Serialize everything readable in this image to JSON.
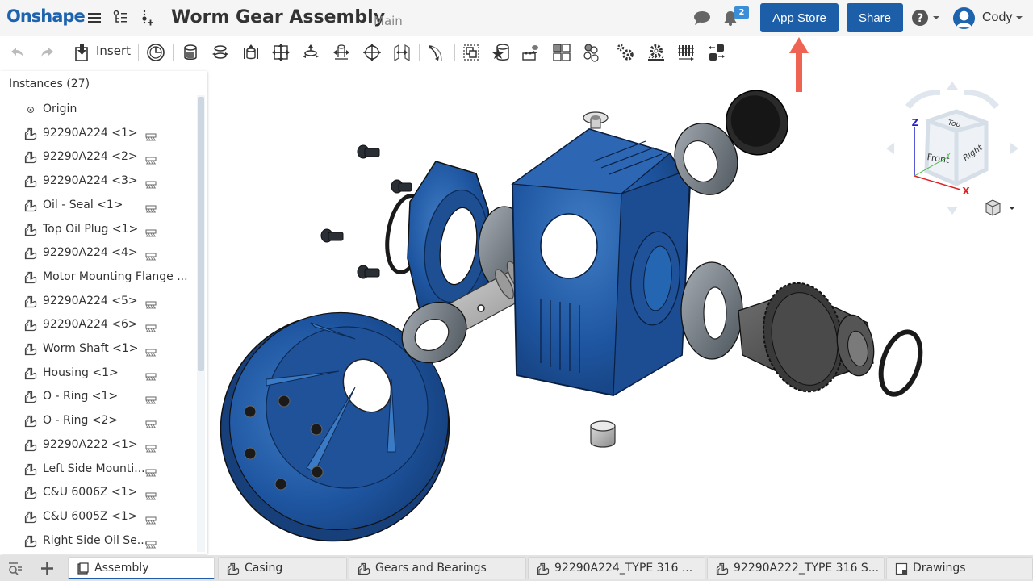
{
  "app": {
    "logo": "Onshape"
  },
  "header": {
    "title": "Worm Gear Assembly",
    "branch": "Main",
    "notification_count": "2",
    "app_store_label": "App Store",
    "share_label": "Share",
    "user_name": "Cody",
    "accent_color": "#1d5ea8"
  },
  "toolbar": {
    "insert_label": "Insert",
    "icons": [
      "undo-icon",
      "redo-icon",
      "insert-icon",
      "history-icon",
      "fastened-mate-icon",
      "revolute-mate-icon",
      "slider-mate-icon",
      "planar-mate-icon",
      "cylindrical-mate-icon",
      "pin-slot-mate-icon",
      "ball-mate-icon",
      "parallel-mate-icon",
      "tangent-mate-icon",
      "group-icon",
      "replicate-icon",
      "mate-connector-icon",
      "pattern-icon",
      "relations-icon",
      "gear-relation-icon",
      "rack-pinion-icon",
      "screw-relation-icon",
      "linear-relation-icon"
    ]
  },
  "instances": {
    "title": "Instances (27)",
    "items": [
      {
        "label": "Origin",
        "type": "origin",
        "mate": false
      },
      {
        "label": "92290A224 <1>",
        "type": "part",
        "mate": true
      },
      {
        "label": "92290A224 <2>",
        "type": "part",
        "mate": true
      },
      {
        "label": "92290A224 <3>",
        "type": "part",
        "mate": true
      },
      {
        "label": "Oil - Seal <1>",
        "type": "part",
        "mate": true
      },
      {
        "label": "Top Oil Plug <1>",
        "type": "part",
        "mate": true
      },
      {
        "label": "92290A224 <4>",
        "type": "part",
        "mate": true
      },
      {
        "label": "Motor Mounting Flange ...",
        "type": "part",
        "mate": false
      },
      {
        "label": "92290A224 <5>",
        "type": "part",
        "mate": true
      },
      {
        "label": "92290A224 <6>",
        "type": "part",
        "mate": true
      },
      {
        "label": "Worm Shaft <1>",
        "type": "part",
        "mate": true
      },
      {
        "label": "Housing <1>",
        "type": "part",
        "mate": true
      },
      {
        "label": "O - Ring <1>",
        "type": "part",
        "mate": true
      },
      {
        "label": "O - Ring <2>",
        "type": "part",
        "mate": true
      },
      {
        "label": "92290A222 <1>",
        "type": "part",
        "mate": true
      },
      {
        "label": "Left Side Mounti...",
        "type": "part",
        "mate": true
      },
      {
        "label": "C&U 6006Z <1>",
        "type": "part",
        "mate": true
      },
      {
        "label": "C&U 6005Z <1>",
        "type": "part",
        "mate": true
      },
      {
        "label": "Right Side Oil Se...",
        "type": "part",
        "mate": true
      }
    ]
  },
  "viewcube": {
    "faces": {
      "top": "Top",
      "front": "Front",
      "right": "Right"
    },
    "axes": {
      "x": "X",
      "y": "Y",
      "z": "Z"
    }
  },
  "tabs": [
    {
      "label": "Assembly",
      "icon": "assembly-icon",
      "active": true
    },
    {
      "label": "Casing",
      "icon": "part-studio-icon",
      "active": false
    },
    {
      "label": "Gears and Bearings",
      "icon": "part-studio-icon",
      "active": false
    },
    {
      "label": "92290A224_TYPE 316 ...",
      "icon": "part-studio-icon",
      "active": false
    },
    {
      "label": "92290A222_TYPE 316 S...",
      "icon": "part-studio-icon",
      "active": false
    },
    {
      "label": "Drawings",
      "icon": "drawing-icon",
      "active": false
    }
  ],
  "annotation": {
    "arrow_color": "#ee6352",
    "target": "App Store"
  }
}
